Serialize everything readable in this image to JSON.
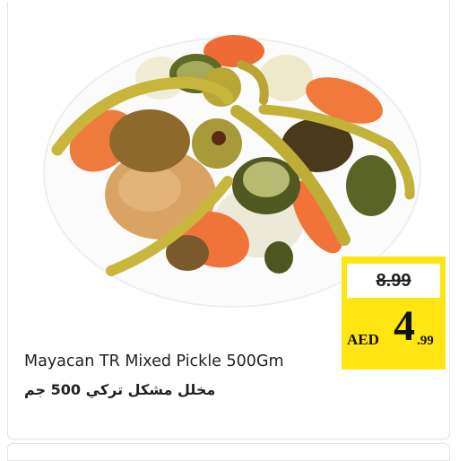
{
  "product": {
    "image_name": "mixed-pickle-plate-photo",
    "name_en": "Mayacan TR Mixed Pickle 500Gm",
    "name_ar": "مخلل مشكل تركي 500 جم"
  },
  "price": {
    "old": "8.99",
    "currency": "AED",
    "integer": "4",
    "decimal": ".99"
  },
  "colors": {
    "price_bg": "#ffe512",
    "text": "#222222",
    "card_border": "#e3e3e3"
  }
}
